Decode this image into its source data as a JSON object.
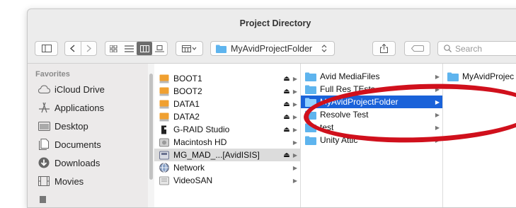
{
  "window": {
    "title": "Project Directory"
  },
  "toolbar": {
    "path_popup_label": "MyAvidProjectFolder",
    "search_placeholder": "Search"
  },
  "sidebar": {
    "header": "Favorites",
    "items": [
      {
        "label": "iCloud Drive",
        "icon": "cloud-icon"
      },
      {
        "label": "Applications",
        "icon": "applications-icon"
      },
      {
        "label": "Desktop",
        "icon": "desktop-icon"
      },
      {
        "label": "Documents",
        "icon": "documents-icon"
      },
      {
        "label": "Downloads",
        "icon": "downloads-icon"
      },
      {
        "label": "Movies",
        "icon": "movies-icon"
      }
    ]
  },
  "column1": {
    "items": [
      {
        "label": "BOOT1",
        "eject": "⏏",
        "chevron": "▶"
      },
      {
        "label": "BOOT2",
        "eject": "⏏",
        "chevron": "▶"
      },
      {
        "label": "DATA1",
        "eject": "⏏",
        "chevron": "▶"
      },
      {
        "label": "DATA2",
        "eject": "⏏",
        "chevron": "▶"
      },
      {
        "label": "G-RAID Studio",
        "eject": "⏏",
        "chevron": "▶"
      },
      {
        "label": "Macintosh HD",
        "eject": "",
        "chevron": "▶"
      },
      {
        "label": "MG_MAD_...[AvidISIS]",
        "eject": "⏏",
        "chevron": "▶"
      },
      {
        "label": "Network",
        "eject": "",
        "chevron": "▶"
      },
      {
        "label": "VideoSAN",
        "eject": "",
        "chevron": "▶"
      }
    ]
  },
  "column2": {
    "items": [
      {
        "label": "Avid MediaFiles",
        "chevron": "▶"
      },
      {
        "label": "Full Res TEsts",
        "chevron": "▶"
      },
      {
        "label": "MyAvidProjectFolder",
        "chevron": "▶"
      },
      {
        "label": "Resolve Test",
        "chevron": "▶"
      },
      {
        "label": "test",
        "chevron": "▶"
      },
      {
        "label": "Unity Attic",
        "chevron": "▶"
      }
    ]
  },
  "column3": {
    "items": [
      {
        "label": "MyAvidProjec"
      }
    ]
  },
  "colors": {
    "selection": "#1a62d9",
    "folder": "#5eb4ee",
    "drive": "#f0a030",
    "annotation": "#d0101c"
  }
}
